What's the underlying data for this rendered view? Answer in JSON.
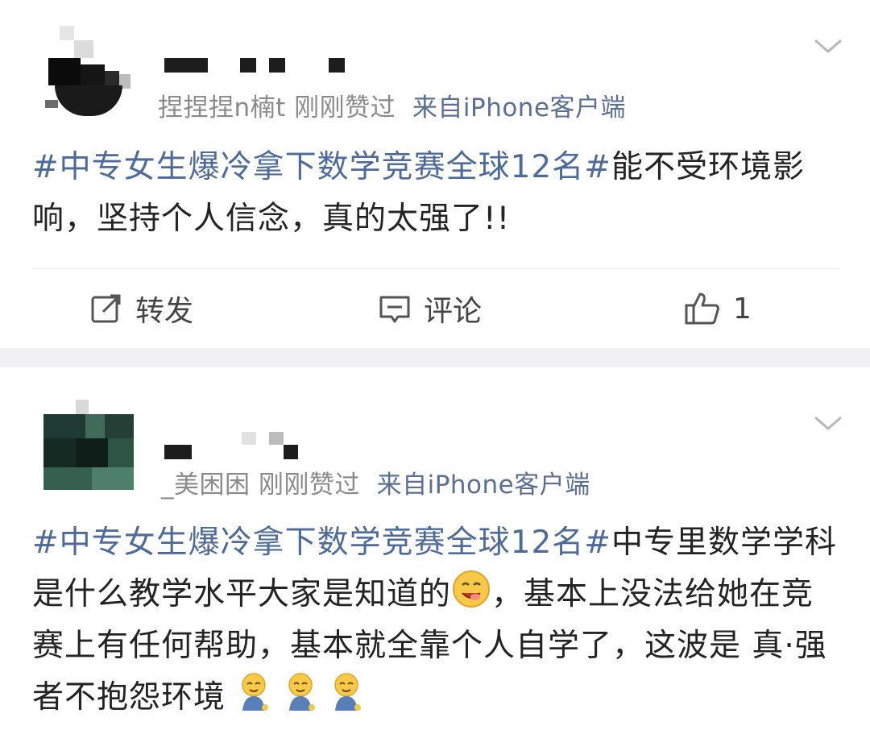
{
  "posts": [
    {
      "meta_user": "捏捏捏n楠t",
      "meta_action": "刚刚赞过",
      "meta_source": "来自iPhone客户端",
      "hashtag": "#中专女生爆冷拿下数学竞赛全球12名#",
      "body": "能不受环境影响，坚持个人信念，真的太强了!!",
      "actions": {
        "repost": "转发",
        "comment": "评论",
        "like_count": "1"
      }
    },
    {
      "meta_user": "_美困困",
      "meta_action": "刚刚赞过",
      "meta_source": "来自iPhone客户端",
      "hashtag": "#中专女生爆冷拿下数学竞赛全球12名#",
      "body_part1": "中专里数学学科是什么教学水平大家是知道的",
      "body_part2": "，基本上没法给她在竞赛上有任何帮助，基本就全靠个人自学了，这波是  真·强者不抱怨环境",
      "emoji_yum": "yum-emoji",
      "emoji_pray": "pray-emoji"
    }
  ],
  "colors": {
    "link": "#4d6a9a",
    "meta": "#8a8a8a",
    "separator": "#f1f1f3"
  }
}
